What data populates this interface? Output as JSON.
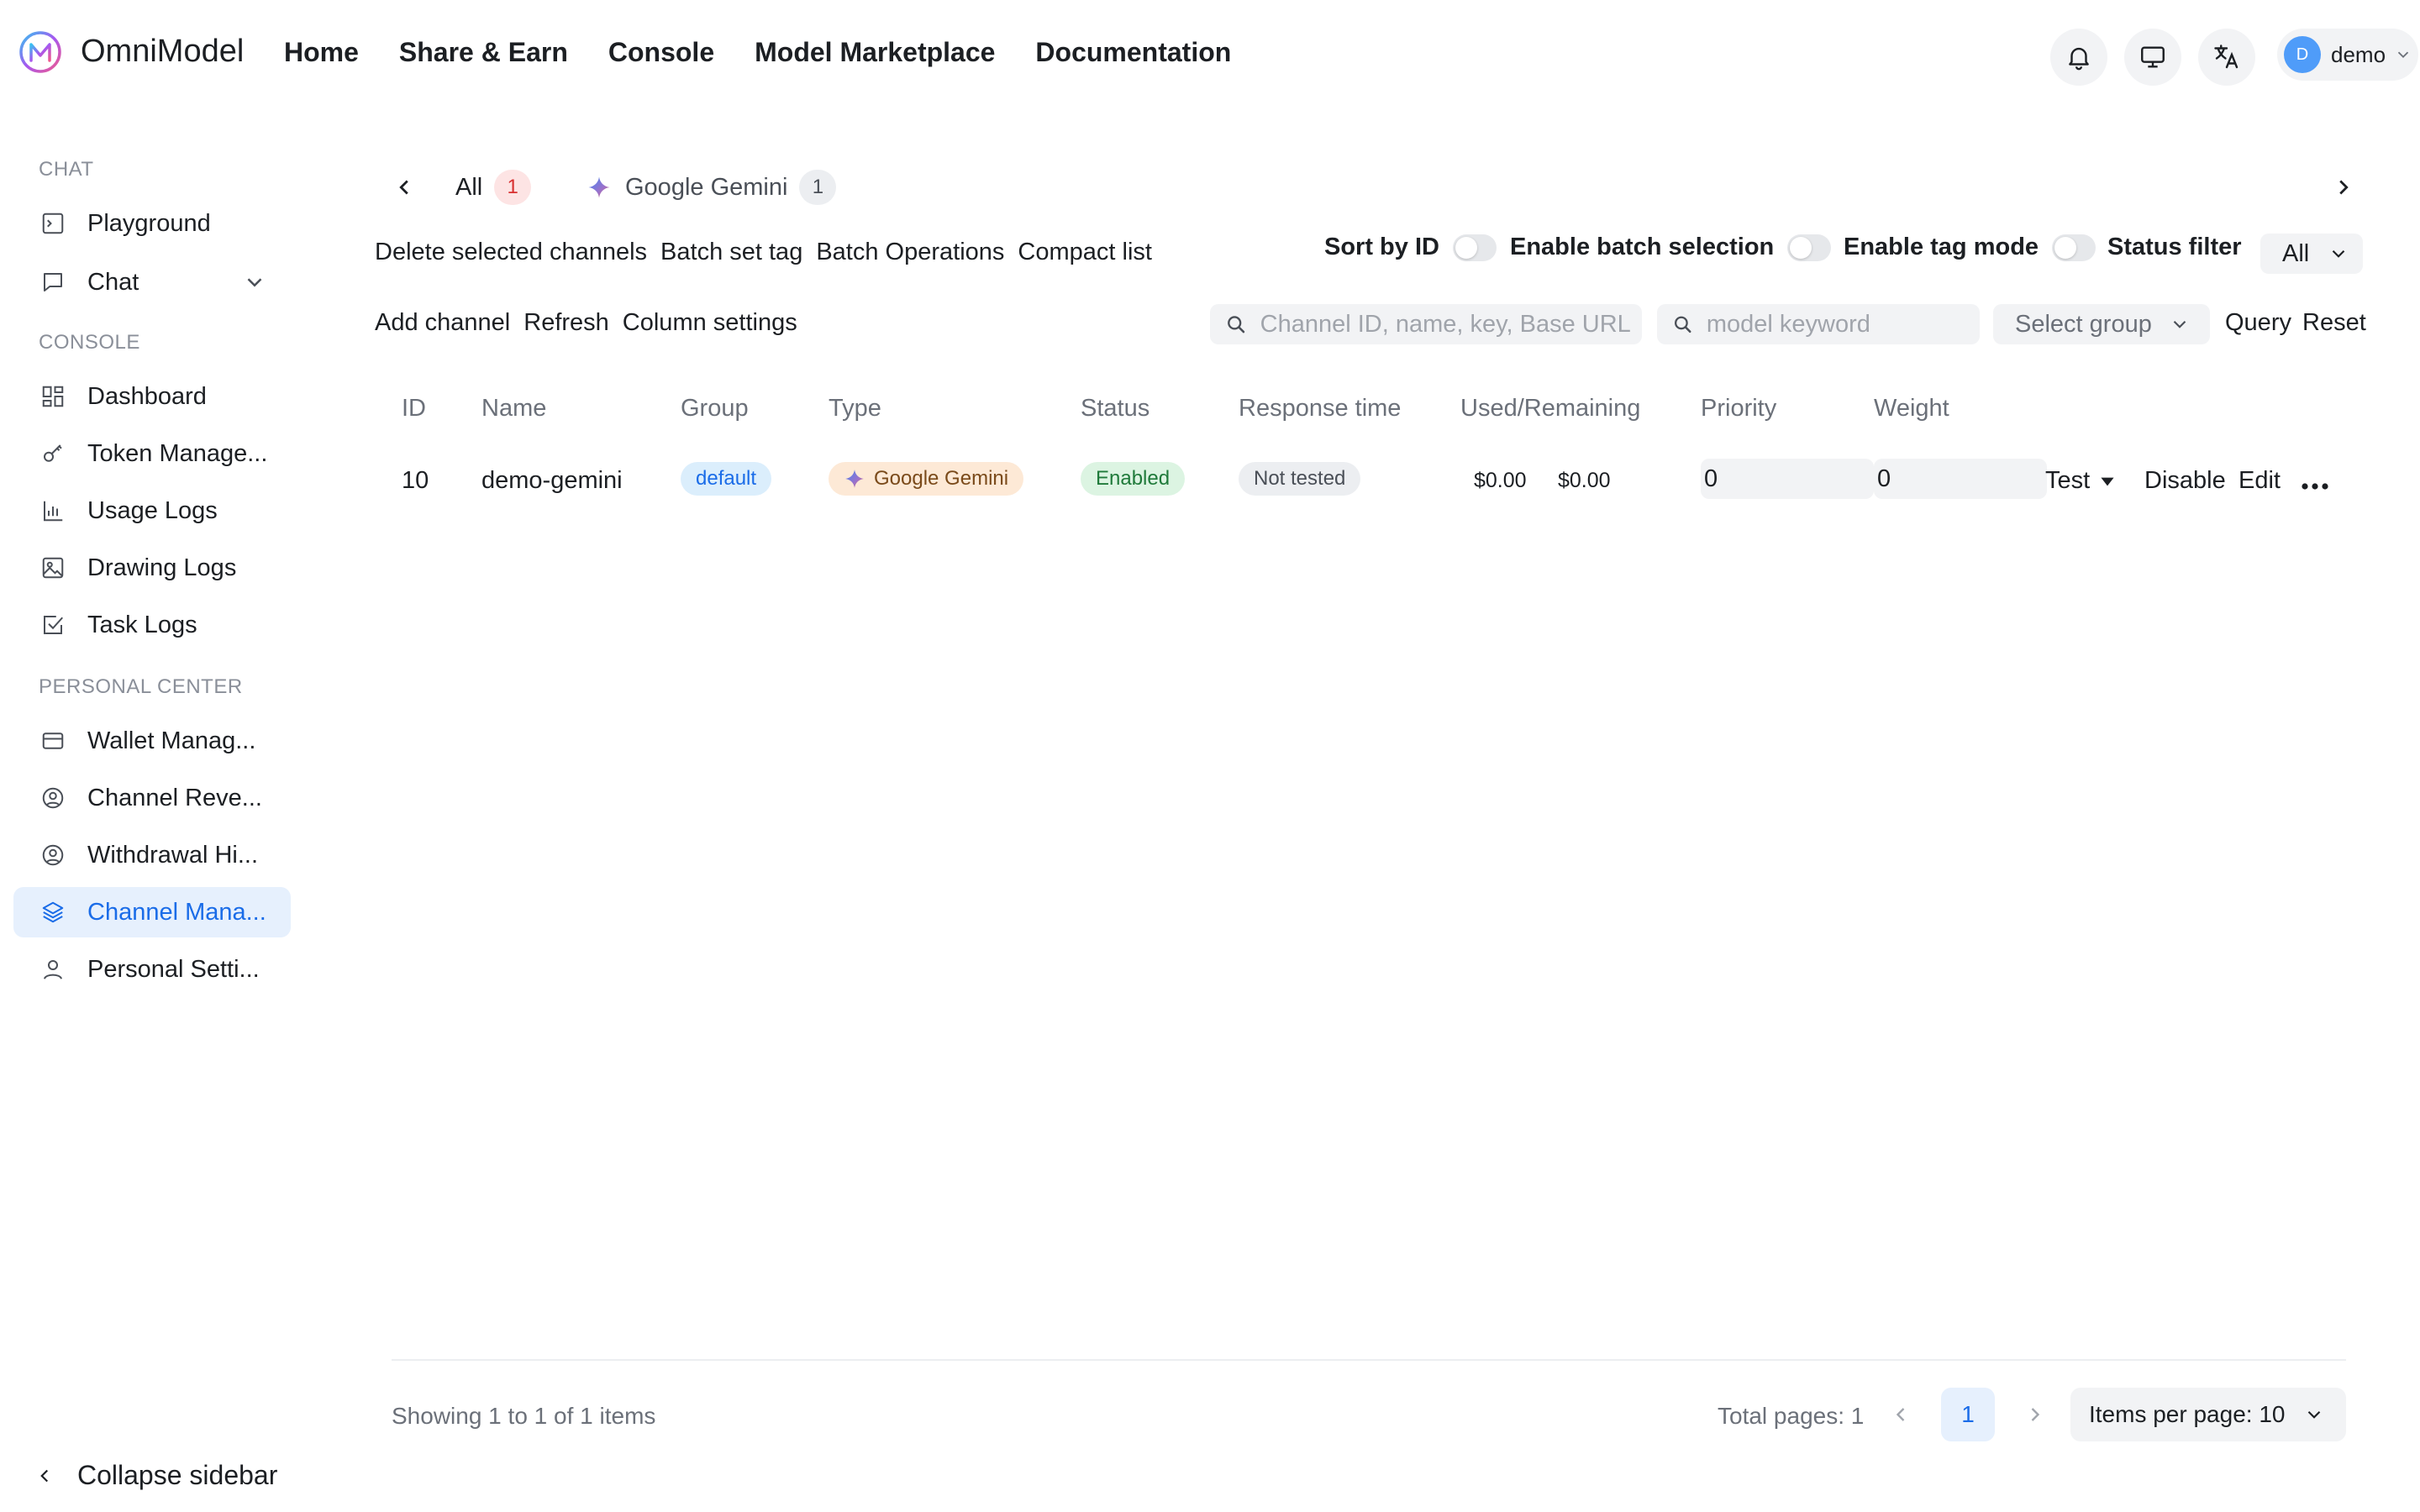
{
  "brand": {
    "name": "OmniModel"
  },
  "topnav": [
    {
      "label": "Home"
    },
    {
      "label": "Share & Earn"
    },
    {
      "label": "Console"
    },
    {
      "label": "Model Marketplace"
    },
    {
      "label": "Documentation"
    }
  ],
  "user": {
    "initial": "D",
    "name": "demo"
  },
  "sidebar": {
    "sections": [
      {
        "title": "CHAT",
        "items": [
          {
            "label": "Playground",
            "icon": "terminal-icon"
          },
          {
            "label": "Chat",
            "icon": "message-icon"
          }
        ]
      },
      {
        "title": "CONSOLE",
        "items": [
          {
            "label": "Dashboard",
            "icon": "grid-icon"
          },
          {
            "label": "Token Manage...",
            "icon": "key-icon"
          },
          {
            "label": "Usage Logs",
            "icon": "bar-chart-icon"
          },
          {
            "label": "Drawing Logs",
            "icon": "image-icon"
          },
          {
            "label": "Task Logs",
            "icon": "check-square-icon"
          }
        ]
      },
      {
        "title": "PERSONAL CENTER",
        "items": [
          {
            "label": "Wallet Manag...",
            "icon": "wallet-icon"
          },
          {
            "label": "Channel Reve...",
            "icon": "user-circle-icon"
          },
          {
            "label": "Withdrawal Hi...",
            "icon": "user-circle-icon"
          },
          {
            "label": "Channel Mana...",
            "icon": "layers-icon"
          },
          {
            "label": "Personal Setti...",
            "icon": "user-icon"
          }
        ]
      }
    ],
    "collapse_label": "Collapse sidebar"
  },
  "tabs": [
    {
      "label": "All",
      "count": "1"
    },
    {
      "label": "Google Gemini",
      "count": "1"
    }
  ],
  "toolbar1": [
    "Delete selected channels",
    "Batch set tag",
    "Batch Operations",
    "Compact list"
  ],
  "toolbar2": [
    "Add channel",
    "Refresh",
    "Column settings"
  ],
  "switches": [
    {
      "label": "Sort by ID"
    },
    {
      "label": "Enable batch selection"
    },
    {
      "label": "Enable tag mode"
    }
  ],
  "status_filter": {
    "label": "Status filter",
    "value": "All"
  },
  "search": {
    "channel_placeholder": "Channel ID, name, key, Base URL",
    "model_placeholder": "model keyword",
    "group_placeholder": "Select group",
    "query_label": "Query",
    "reset_label": "Reset"
  },
  "table": {
    "headers": [
      "ID",
      "Name",
      "Group",
      "Type",
      "Status",
      "Response time",
      "Used/Remaining",
      "Priority",
      "Weight"
    ],
    "rows": [
      {
        "id": "10",
        "name": "demo-gemini",
        "group": "default",
        "type": "Google Gemini",
        "status": "Enabled",
        "response_time": "Not tested",
        "used": "$0.00",
        "remaining": "$0.00",
        "priority": "0",
        "weight": "0",
        "actions": {
          "test": "Test",
          "disable": "Disable",
          "edit": "Edit"
        }
      }
    ]
  },
  "footer": {
    "showing": "Showing 1 to 1 of 1 items",
    "total_pages": "Total pages: 1",
    "current_page": "1",
    "per_page": "Items per page: 10"
  },
  "colors": {
    "accent": "#1a6ce8",
    "active_bg": "#e6f0fd",
    "badge_red_bg": "#fde4e4",
    "badge_red_text": "#d83030"
  }
}
